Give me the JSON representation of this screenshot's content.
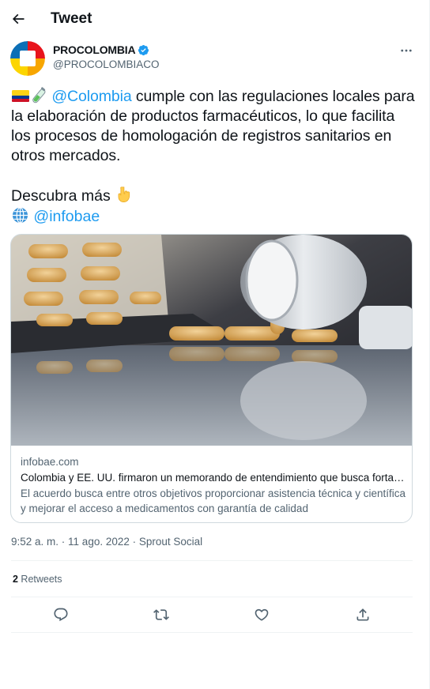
{
  "header": {
    "title": "Tweet"
  },
  "author": {
    "name": "PROCOLOMBIA",
    "handle": "@PROCOLOMBIACO"
  },
  "tweet": {
    "mention": "@Colombia",
    "text": " cumple con las regulaciones locales para la elaboración de productos farmacéuticos, lo que facilita los procesos de homologación de registros sanitarios en otros mercados.",
    "line2": "Descubra más",
    "link": "@infobae"
  },
  "card": {
    "domain": "infobae.com",
    "title": "Colombia y EE. UU. firmaron un memorando de entendimiento que busca fortal…",
    "description": "El acuerdo busca entre otros objetivos proporcionar asistencia técnica y científica y mejorar el acceso a medicamentos con garantía de calidad"
  },
  "meta": {
    "time": "9:52 a. m.",
    "separator": " · ",
    "date": "11 ago. 2022",
    "source": "Sprout Social"
  },
  "stats": {
    "retweet_count": "2",
    "retweet_label": " Retweets"
  },
  "icons": {
    "back": "arrow-left-icon",
    "verified": "verified-badge-icon",
    "more": "more-icon",
    "reply": "reply-icon",
    "retweet": "retweet-icon",
    "like": "heart-icon",
    "share": "share-icon"
  },
  "colors": {
    "accent": "#1d9bf0",
    "text": "#0f1419",
    "secondary": "#536471",
    "border": "#cfd9de"
  }
}
